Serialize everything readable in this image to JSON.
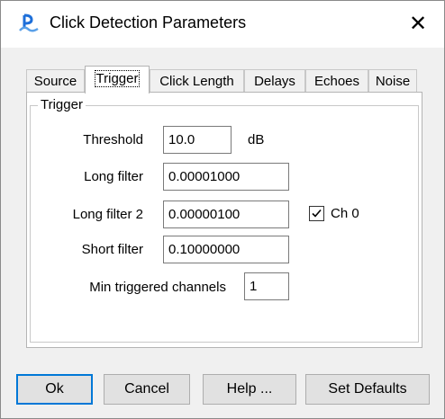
{
  "window": {
    "title": "Click Detection Parameters",
    "app_icon": "pamguard-icon",
    "close_glyph": "✕"
  },
  "tabs": [
    {
      "label": "Source",
      "selected": false
    },
    {
      "label": "Trigger",
      "selected": true
    },
    {
      "label": "Click Length",
      "selected": false
    },
    {
      "label": "Delays",
      "selected": false
    },
    {
      "label": "Echoes",
      "selected": false
    },
    {
      "label": "Noise",
      "selected": false
    }
  ],
  "trigger": {
    "group_label": "Trigger",
    "threshold_label": "Threshold",
    "threshold_value": "10.0",
    "threshold_unit": "dB",
    "long_filter_label": "Long filter",
    "long_filter_value": "0.00001000",
    "long_filter2_label": "Long filter 2",
    "long_filter2_value": "0.00000100",
    "short_filter_label": "Short filter",
    "short_filter_value": "0.10000000",
    "min_channels_label": "Min triggered channels",
    "min_channels_value": "1",
    "channel_checkbox_label": "Ch 0",
    "channel_checkbox_checked": true
  },
  "buttons": {
    "ok": "Ok",
    "cancel": "Cancel",
    "help": "Help ...",
    "set_defaults": "Set Defaults"
  },
  "colors": {
    "default_button_border": "#0078d7",
    "app_icon": "#1e6fd9"
  }
}
